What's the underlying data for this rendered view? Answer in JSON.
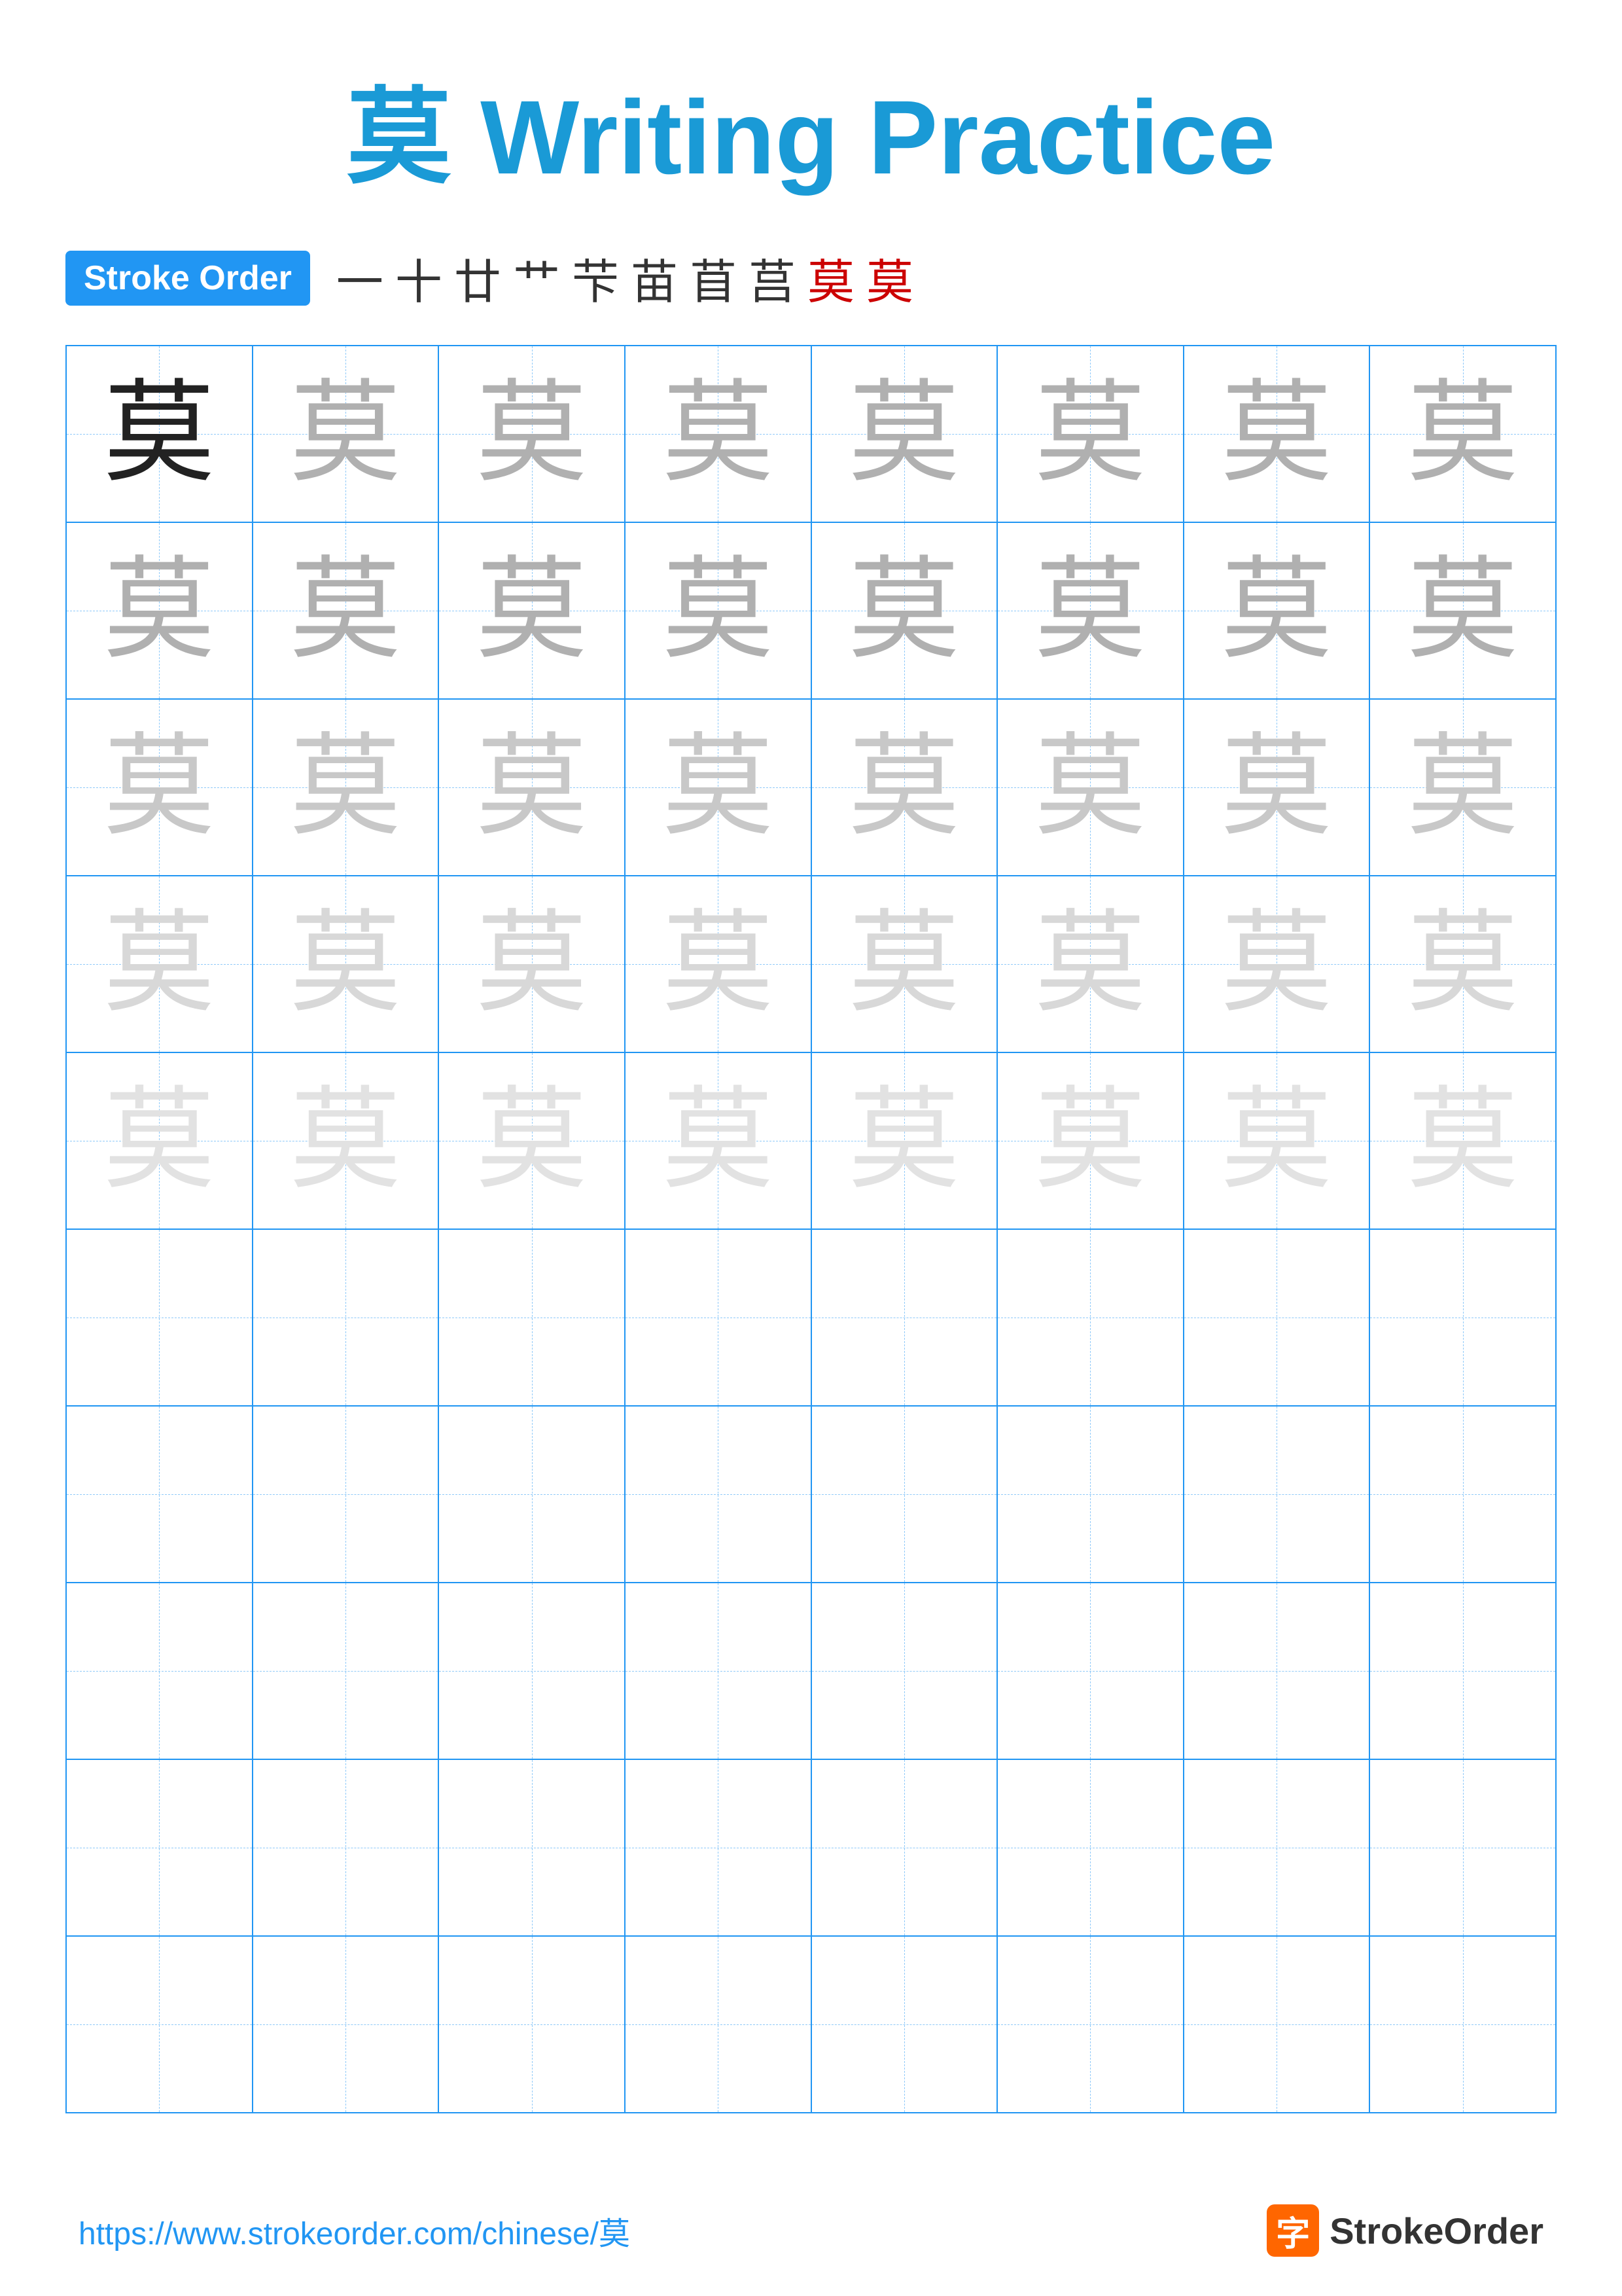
{
  "title": {
    "chinese": "莫",
    "english": " Writing Practice"
  },
  "stroke_order": {
    "badge_label": "Stroke Order",
    "sequence": [
      "一",
      "十",
      "廿",
      "艹",
      "芐",
      "苗",
      "苜",
      "莒",
      "莫",
      "莫"
    ],
    "red_indices": [
      8,
      9
    ]
  },
  "grid": {
    "rows": 10,
    "cols": 8,
    "char": "莫",
    "filled_rows": 5,
    "shade_levels": [
      "dark",
      "gray1",
      "gray2",
      "gray3",
      "gray4"
    ]
  },
  "footer": {
    "url": "https://www.strokeorder.com/chinese/莫",
    "logo_char": "字",
    "logo_text": "StrokeOrder"
  }
}
